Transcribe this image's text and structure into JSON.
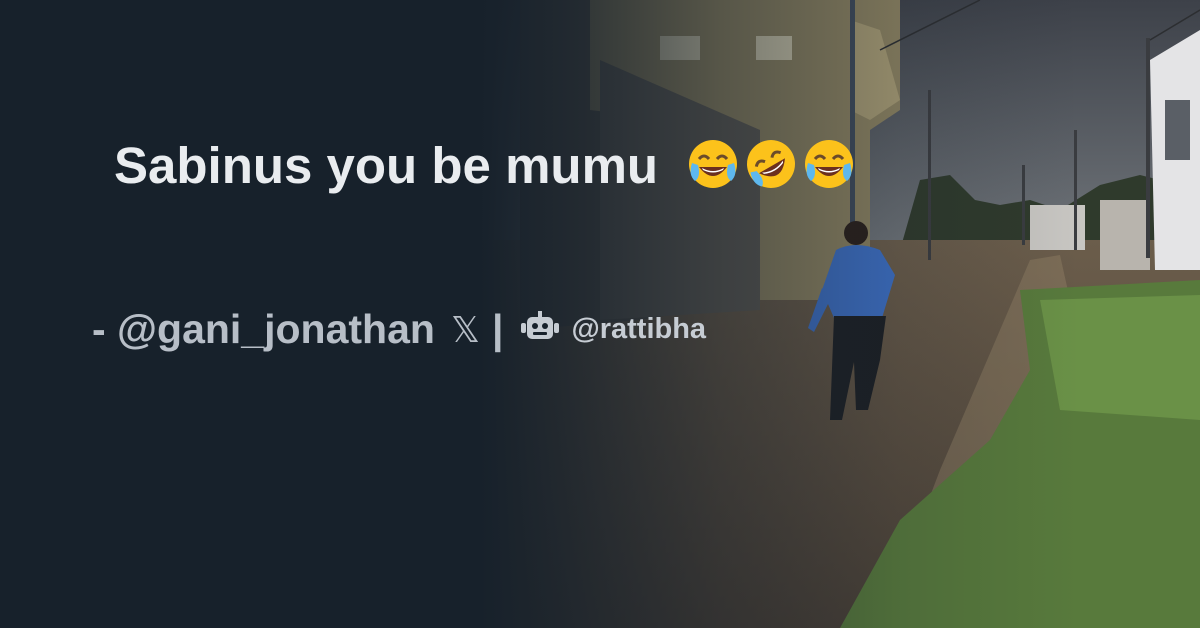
{
  "quote": {
    "text": "Sabinus you be mumu",
    "emojis": [
      "face-with-tears-of-joy-icon",
      "rolling-on-the-floor-laughing-icon",
      "face-with-tears-of-joy-icon"
    ]
  },
  "attribution": {
    "author": "- @gani_jonathan",
    "platform_mark": "𝕏",
    "separator": "|",
    "brand_icon": "robot-icon",
    "brand": "@rattibha"
  },
  "colors": {
    "panel": "#17212b",
    "quote_text": "#e9ecef",
    "attribution_text": "#b7bec7"
  }
}
